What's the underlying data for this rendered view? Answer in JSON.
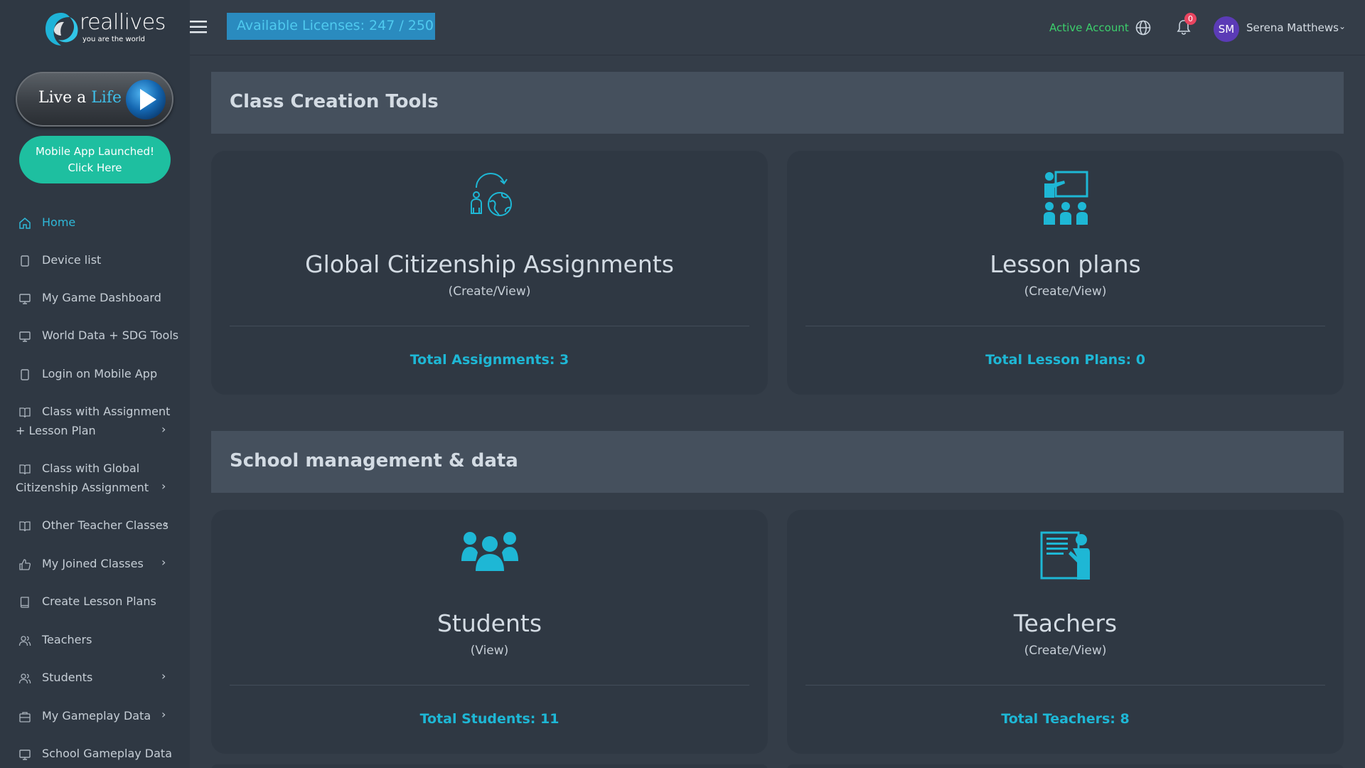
{
  "brand": {
    "name": "reallives",
    "tagline": "you are the world"
  },
  "live_life": {
    "prefix": "Live a ",
    "highlight": "Life"
  },
  "mobile_app": {
    "line1": "Mobile App Launched!",
    "line2": "Click Here"
  },
  "sidebar": {
    "items": [
      {
        "label": "Home",
        "icon": "home-icon"
      },
      {
        "label": "Device list",
        "icon": "phone-icon"
      },
      {
        "label": "My Game Dashboard",
        "icon": "monitor-icon"
      },
      {
        "label": "World Data + SDG Tools",
        "icon": "monitor-icon"
      },
      {
        "label": "Login on Mobile App",
        "icon": "phone-icon"
      },
      {
        "label": "Class with Assignment",
        "label2": "+ Lesson Plan",
        "icon": "book-open-icon"
      },
      {
        "label": "Class with Global",
        "label2": "Citizenship Assignment",
        "icon": "book-open-icon"
      },
      {
        "label": "Other Teacher Classes",
        "icon": "book-open-icon"
      },
      {
        "label": "My Joined Classes",
        "icon": "thumbs-up-icon"
      },
      {
        "label": "Create Lesson Plans",
        "icon": "book-icon"
      },
      {
        "label": "Teachers",
        "icon": "users-icon"
      },
      {
        "label": "Students",
        "icon": "users-icon"
      },
      {
        "label": "My Gameplay Data",
        "icon": "briefcase-icon"
      },
      {
        "label": "School Gameplay Data",
        "icon": "monitor-icon"
      }
    ]
  },
  "topbar": {
    "licenses": "Available Licenses: 247 / 250",
    "account_status": "Active Account",
    "notifications": "0",
    "avatar_initials": "SM",
    "user_name": "Serena Matthews"
  },
  "sections": [
    {
      "title": "Class Creation Tools",
      "cards": [
        {
          "title": "Global Citizenship Assignments",
          "subtitle": "(Create/View)",
          "total": "Total Assignments: 3",
          "icon": "global-citizen-icon"
        },
        {
          "title": "Lesson plans",
          "subtitle": "(Create/View)",
          "total": "Total Lesson Plans: 0",
          "icon": "classroom-teacher-icon"
        }
      ]
    },
    {
      "title": "School management & data",
      "cards": [
        {
          "title": "Students",
          "subtitle": "(View)",
          "total": "Total Students: 11",
          "icon": "students-group-icon"
        },
        {
          "title": "Teachers",
          "subtitle": "(Create/View)",
          "total": "Total Teachers: 8",
          "icon": "teacher-board-icon"
        }
      ]
    }
  ],
  "colors": {
    "accent": "#1eb7d5",
    "active_green": "#3ccf6c",
    "mobile_button": "#1ebfa0",
    "badge_red": "#e94560",
    "avatar_purple": "#5b3bb6"
  }
}
